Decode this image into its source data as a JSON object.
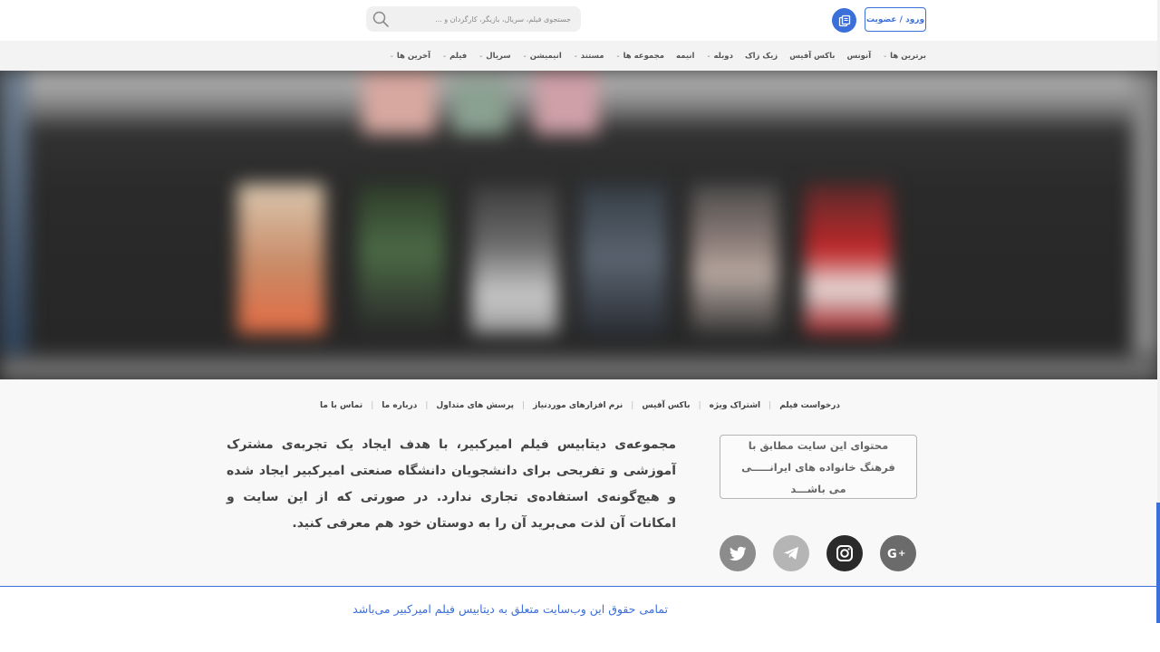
{
  "header": {
    "login_label": "ورود / عضویت",
    "subscription_icon": "subscription-icon",
    "search": {
      "placeholder": "جستجوی فیلم، سریال، بازیگر، کارگردان و ...",
      "value": "",
      "icon": "search-icon"
    }
  },
  "nav": {
    "items": [
      {
        "label": "آخرین ها",
        "dropdown": true
      },
      {
        "label": "فیلم",
        "dropdown": true
      },
      {
        "label": "سریال",
        "dropdown": true
      },
      {
        "label": "انیمیشن",
        "dropdown": true
      },
      {
        "label": "مستند",
        "dropdown": true
      },
      {
        "label": "مجموعه ها",
        "dropdown": true
      },
      {
        "label": "انیمه",
        "dropdown": false
      },
      {
        "label": "دوبله",
        "dropdown": true
      },
      {
        "label": "زیک زاک",
        "dropdown": false
      },
      {
        "label": "باکس آفیس",
        "dropdown": false
      },
      {
        "label": "آنونس",
        "dropdown": false
      },
      {
        "label": "برترین ها",
        "dropdown": true
      }
    ]
  },
  "footer": {
    "links": [
      "درخواست فیلم",
      "اشتراک ویژه",
      "باکس آفیس",
      "نرم افزارهای موردنیاز",
      "پرسش های متداول",
      "درباره ما",
      "تماس با ما"
    ],
    "notice": "محتوای این سایت مطابق با فرهنگ خانواده های ایرانـــــی می باشـــد",
    "about": "مجموعه‌ی دیتابیس فیلم امیرکبیر، با هدف ایجاد یک تجربه‌ی مشترک آموزشی و تفریحی برای دانشجویان دانشگاه صنعتی امیرکبیر ایجاد شده و هیچ‌گونه‌ی استفاده‌ی تجاری ندارد. در صورتی که از این سایت و امکانات آن لذت می‌برید آن را به دوستان خود هم معرفی کنید.",
    "social": [
      {
        "name": "google-plus-icon"
      },
      {
        "name": "instagram-icon"
      },
      {
        "name": "telegram-icon"
      },
      {
        "name": "twitter-icon"
      }
    ],
    "copyright": "تمامی حقوق این وب‌سایت متعلق به دیتابیس فیلم امیرکبیر می‌باشد"
  },
  "colors": {
    "accent": "#3b6fd9"
  }
}
